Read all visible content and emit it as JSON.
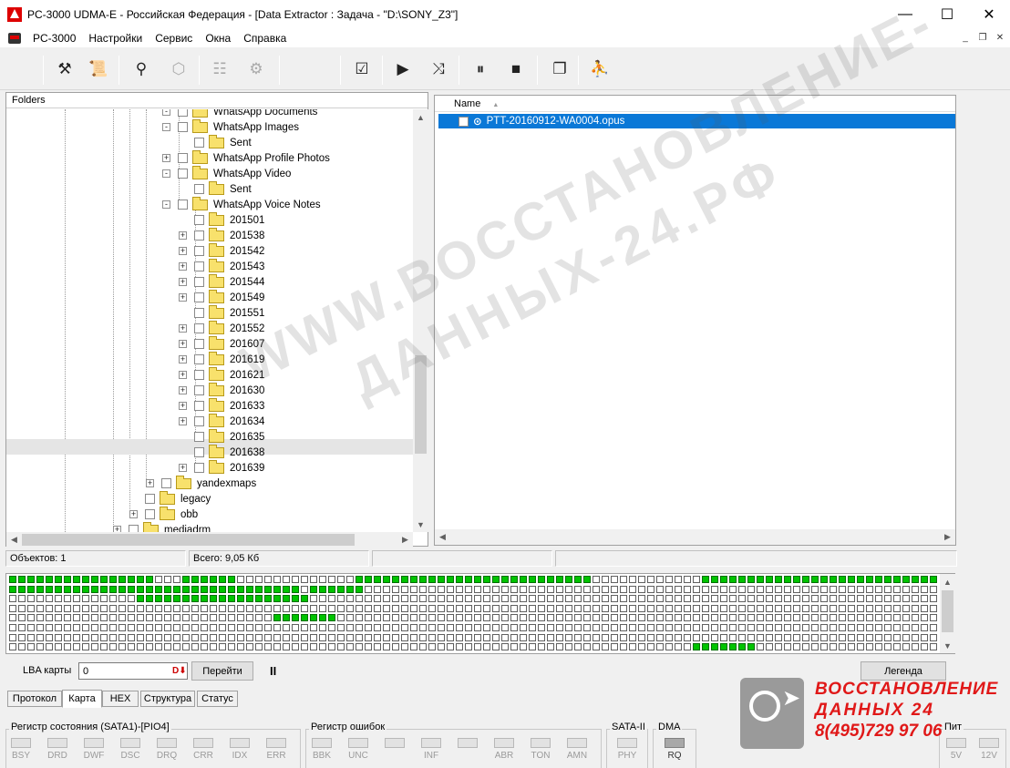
{
  "window": {
    "title": "PC-3000 UDMA-E - Российская Федерация - [Data Extractor : Задача - \"D:\\SONY_Z3\"]",
    "minimize": "—",
    "maximize": "☐",
    "close": "✕"
  },
  "menu": {
    "items": [
      "PC-3000",
      "Настройки",
      "Сервис",
      "Окна",
      "Справка"
    ],
    "mdi_minimize": "_",
    "mdi_restore": "❐",
    "mdi_close": "✕"
  },
  "toolbar": {
    "tools": "⚒",
    "scroll": "📜",
    "find": "⚲",
    "import": "⬡",
    "tree": "☷",
    "tree2": "⚙",
    "task": "☑",
    "play": "▶",
    "split": "⤨",
    "pause": "⏸",
    "stop": "■",
    "copy": "❐",
    "exit": "⛹"
  },
  "tree": {
    "header": "Folders",
    "rows": [
      {
        "label": "WhatsApp Documents",
        "depth": 3,
        "exp": "-"
      },
      {
        "label": "WhatsApp Images",
        "depth": 3,
        "exp": "-"
      },
      {
        "label": "Sent",
        "depth": 4,
        "exp": ""
      },
      {
        "label": "WhatsApp Profile Photos",
        "depth": 3,
        "exp": "+"
      },
      {
        "label": "WhatsApp Video",
        "depth": 3,
        "exp": "-"
      },
      {
        "label": "Sent",
        "depth": 4,
        "exp": ""
      },
      {
        "label": "WhatsApp Voice Notes",
        "depth": 3,
        "exp": "-"
      },
      {
        "label": "201501",
        "depth": 4,
        "exp": ""
      },
      {
        "label": "201538",
        "depth": 4,
        "exp": "+"
      },
      {
        "label": "201542",
        "depth": 4,
        "exp": "+"
      },
      {
        "label": "201543",
        "depth": 4,
        "exp": "+"
      },
      {
        "label": "201544",
        "depth": 4,
        "exp": "+"
      },
      {
        "label": "201549",
        "depth": 4,
        "exp": "+"
      },
      {
        "label": "201551",
        "depth": 4,
        "exp": ""
      },
      {
        "label": "201552",
        "depth": 4,
        "exp": "+"
      },
      {
        "label": "201607",
        "depth": 4,
        "exp": "+"
      },
      {
        "label": "201619",
        "depth": 4,
        "exp": "+"
      },
      {
        "label": "201621",
        "depth": 4,
        "exp": "+"
      },
      {
        "label": "201630",
        "depth": 4,
        "exp": "+"
      },
      {
        "label": "201633",
        "depth": 4,
        "exp": "+"
      },
      {
        "label": "201634",
        "depth": 4,
        "exp": "+"
      },
      {
        "label": "201635",
        "depth": 4,
        "exp": ""
      },
      {
        "label": "201638",
        "depth": 4,
        "exp": "",
        "selected": true
      },
      {
        "label": "201639",
        "depth": 4,
        "exp": "+"
      },
      {
        "label": "yandexmaps",
        "depth": 2,
        "exp": "+"
      },
      {
        "label": "legacy",
        "depth": 1,
        "exp": ""
      },
      {
        "label": "obb",
        "depth": 1,
        "exp": "+"
      },
      {
        "label": "mediadrm",
        "depth": 0,
        "exp": "+"
      }
    ]
  },
  "files": {
    "header": "Name",
    "sort_arrow": "▲",
    "row": "PTT-20160912-WA0004.opus",
    "row_icon": "⊙"
  },
  "scroll_arrows": {
    "up": "▲",
    "down": "▼",
    "left": "◀",
    "right": "▶"
  },
  "status": {
    "objects": "Объектов: 1",
    "total": "Всего: 9,05 Кб"
  },
  "map": {
    "columns": 102,
    "rows": 8,
    "green_ranges": [
      [
        [
          0,
          15
        ],
        [
          19,
          24
        ],
        [
          38,
          63
        ],
        [
          76,
          101
        ]
      ],
      [
        [
          0,
          13
        ],
        [
          14,
          31
        ],
        [
          33,
          38
        ]
      ],
      [
        [
          14,
          32
        ]
      ],
      [],
      [
        [
          29,
          35
        ]
      ],
      [],
      [],
      [
        [
          75,
          81
        ]
      ]
    ]
  },
  "controls": {
    "lba_label": "LBA карты",
    "lba_value": "0",
    "lba_btn": "D⬇",
    "goto": "Перейти",
    "pause": "II",
    "legend": "Легенда"
  },
  "tabs": [
    "Протокол",
    "Карта",
    "HEX",
    "Структура",
    "Статус"
  ],
  "active_tab": "Карта",
  "registers": {
    "status_title": "Регистр состояния (SATA1)-[PIO4]",
    "status_leds": [
      "BSY",
      "DRD",
      "DWF",
      "DSC",
      "DRQ",
      "CRR",
      "IDX",
      "ERR"
    ],
    "error_title": "Регистр ошибок",
    "error_leds": [
      "BBK",
      "UNC",
      "",
      "INF",
      "",
      "ABR",
      "TON",
      "AMN"
    ],
    "sata_title": "SATA-II",
    "sata_leds": [
      "PHY"
    ],
    "dma_title": "DMA",
    "dma_leds": [
      "RQ"
    ],
    "power_title": "Пит",
    "power_leds": [
      "5V",
      "12V"
    ]
  },
  "watermark": {
    "line1": "WWW.ВОССТАНОВЛЕНИЕ-",
    "line2": "ДАННЫХ-24.РФ"
  },
  "brand": {
    "line1": "ВОССТАНОВЛЕНИЕ",
    "line2": "ДАННЫХ 24",
    "line3": "8(495)729 97 06",
    "color": "#e01818"
  }
}
